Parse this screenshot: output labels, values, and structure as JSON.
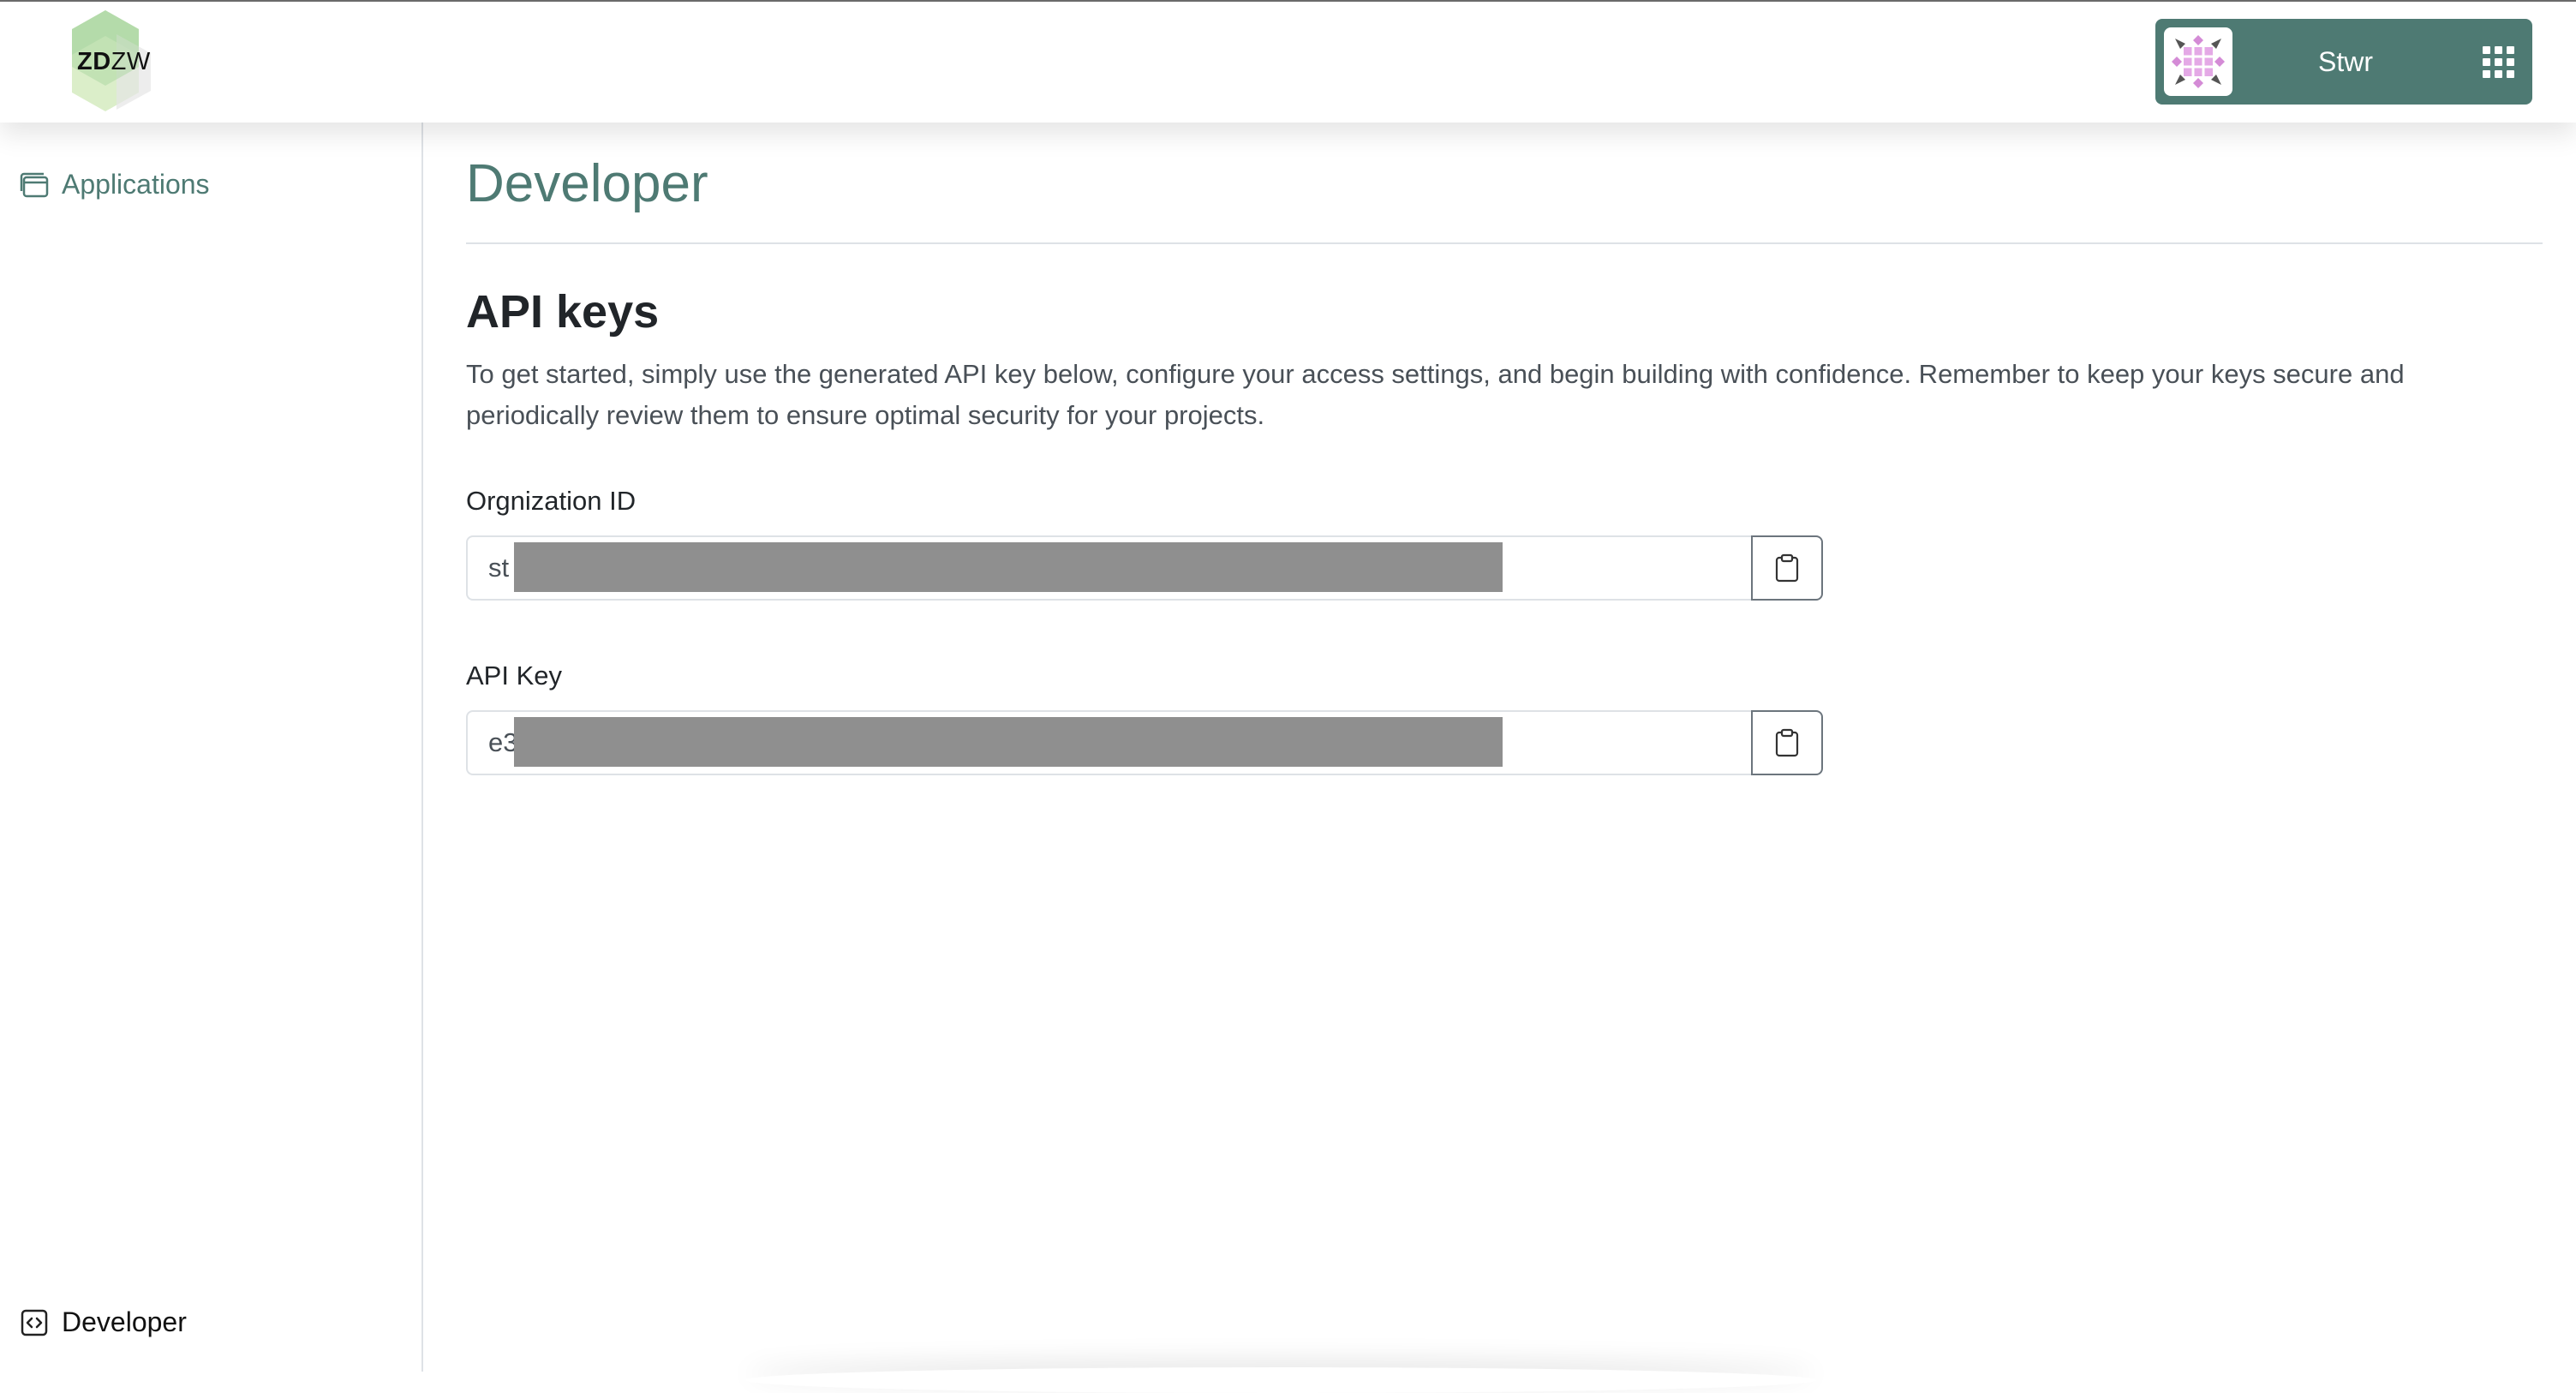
{
  "header": {
    "logo_text_bold": "ZD",
    "logo_text_light": "ZW",
    "user_name": "Stwr",
    "avatar_icon": "identicon-avatar",
    "apps_icon": "grid-apps-icon",
    "accent_color": "#4e7a73"
  },
  "sidebar": {
    "items": [
      {
        "label": "Applications",
        "icon": "window-stack-icon"
      },
      {
        "label": "Developer",
        "icon": "code-square-icon"
      }
    ]
  },
  "main": {
    "page_title": "Developer",
    "section_title": "API keys",
    "description": "To get started, simply use the generated API key below, configure your access settings, and begin building with confidence. Remember to keep your keys secure and periodically review them to ensure optimal security for your projects.",
    "fields": [
      {
        "label": "Orgnization ID",
        "value_visible": "st",
        "copy_icon": "clipboard-icon"
      },
      {
        "label": "API Key",
        "value_visible": "e3",
        "copy_icon": "clipboard-icon"
      }
    ]
  }
}
